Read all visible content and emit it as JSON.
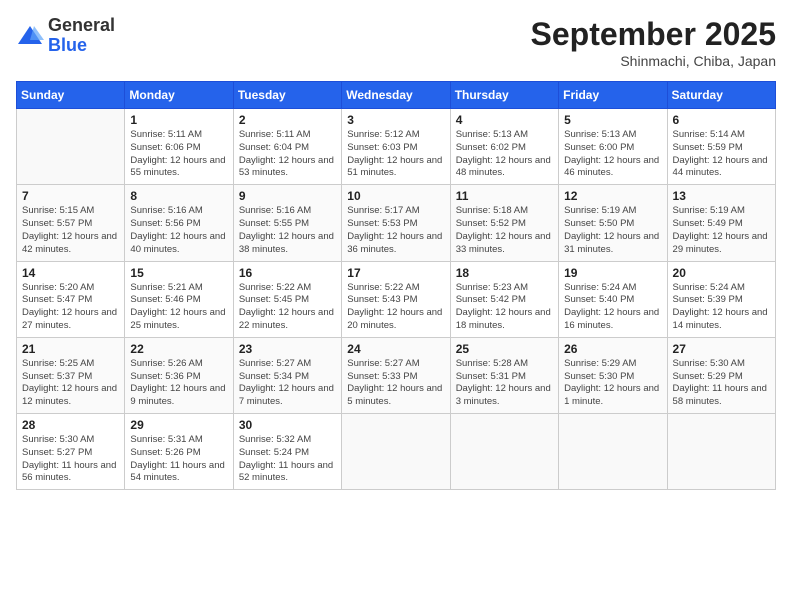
{
  "header": {
    "logo_general": "General",
    "logo_blue": "Blue",
    "month_title": "September 2025",
    "subtitle": "Shinmachi, Chiba, Japan"
  },
  "weekdays": [
    "Sunday",
    "Monday",
    "Tuesday",
    "Wednesday",
    "Thursday",
    "Friday",
    "Saturday"
  ],
  "weeks": [
    [
      {
        "day": "",
        "sunrise": "",
        "sunset": "",
        "daylight": ""
      },
      {
        "day": "1",
        "sunrise": "Sunrise: 5:11 AM",
        "sunset": "Sunset: 6:06 PM",
        "daylight": "Daylight: 12 hours and 55 minutes."
      },
      {
        "day": "2",
        "sunrise": "Sunrise: 5:11 AM",
        "sunset": "Sunset: 6:04 PM",
        "daylight": "Daylight: 12 hours and 53 minutes."
      },
      {
        "day": "3",
        "sunrise": "Sunrise: 5:12 AM",
        "sunset": "Sunset: 6:03 PM",
        "daylight": "Daylight: 12 hours and 51 minutes."
      },
      {
        "day": "4",
        "sunrise": "Sunrise: 5:13 AM",
        "sunset": "Sunset: 6:02 PM",
        "daylight": "Daylight: 12 hours and 48 minutes."
      },
      {
        "day": "5",
        "sunrise": "Sunrise: 5:13 AM",
        "sunset": "Sunset: 6:00 PM",
        "daylight": "Daylight: 12 hours and 46 minutes."
      },
      {
        "day": "6",
        "sunrise": "Sunrise: 5:14 AM",
        "sunset": "Sunset: 5:59 PM",
        "daylight": "Daylight: 12 hours and 44 minutes."
      }
    ],
    [
      {
        "day": "7",
        "sunrise": "Sunrise: 5:15 AM",
        "sunset": "Sunset: 5:57 PM",
        "daylight": "Daylight: 12 hours and 42 minutes."
      },
      {
        "day": "8",
        "sunrise": "Sunrise: 5:16 AM",
        "sunset": "Sunset: 5:56 PM",
        "daylight": "Daylight: 12 hours and 40 minutes."
      },
      {
        "day": "9",
        "sunrise": "Sunrise: 5:16 AM",
        "sunset": "Sunset: 5:55 PM",
        "daylight": "Daylight: 12 hours and 38 minutes."
      },
      {
        "day": "10",
        "sunrise": "Sunrise: 5:17 AM",
        "sunset": "Sunset: 5:53 PM",
        "daylight": "Daylight: 12 hours and 36 minutes."
      },
      {
        "day": "11",
        "sunrise": "Sunrise: 5:18 AM",
        "sunset": "Sunset: 5:52 PM",
        "daylight": "Daylight: 12 hours and 33 minutes."
      },
      {
        "day": "12",
        "sunrise": "Sunrise: 5:19 AM",
        "sunset": "Sunset: 5:50 PM",
        "daylight": "Daylight: 12 hours and 31 minutes."
      },
      {
        "day": "13",
        "sunrise": "Sunrise: 5:19 AM",
        "sunset": "Sunset: 5:49 PM",
        "daylight": "Daylight: 12 hours and 29 minutes."
      }
    ],
    [
      {
        "day": "14",
        "sunrise": "Sunrise: 5:20 AM",
        "sunset": "Sunset: 5:47 PM",
        "daylight": "Daylight: 12 hours and 27 minutes."
      },
      {
        "day": "15",
        "sunrise": "Sunrise: 5:21 AM",
        "sunset": "Sunset: 5:46 PM",
        "daylight": "Daylight: 12 hours and 25 minutes."
      },
      {
        "day": "16",
        "sunrise": "Sunrise: 5:22 AM",
        "sunset": "Sunset: 5:45 PM",
        "daylight": "Daylight: 12 hours and 22 minutes."
      },
      {
        "day": "17",
        "sunrise": "Sunrise: 5:22 AM",
        "sunset": "Sunset: 5:43 PM",
        "daylight": "Daylight: 12 hours and 20 minutes."
      },
      {
        "day": "18",
        "sunrise": "Sunrise: 5:23 AM",
        "sunset": "Sunset: 5:42 PM",
        "daylight": "Daylight: 12 hours and 18 minutes."
      },
      {
        "day": "19",
        "sunrise": "Sunrise: 5:24 AM",
        "sunset": "Sunset: 5:40 PM",
        "daylight": "Daylight: 12 hours and 16 minutes."
      },
      {
        "day": "20",
        "sunrise": "Sunrise: 5:24 AM",
        "sunset": "Sunset: 5:39 PM",
        "daylight": "Daylight: 12 hours and 14 minutes."
      }
    ],
    [
      {
        "day": "21",
        "sunrise": "Sunrise: 5:25 AM",
        "sunset": "Sunset: 5:37 PM",
        "daylight": "Daylight: 12 hours and 12 minutes."
      },
      {
        "day": "22",
        "sunrise": "Sunrise: 5:26 AM",
        "sunset": "Sunset: 5:36 PM",
        "daylight": "Daylight: 12 hours and 9 minutes."
      },
      {
        "day": "23",
        "sunrise": "Sunrise: 5:27 AM",
        "sunset": "Sunset: 5:34 PM",
        "daylight": "Daylight: 12 hours and 7 minutes."
      },
      {
        "day": "24",
        "sunrise": "Sunrise: 5:27 AM",
        "sunset": "Sunset: 5:33 PM",
        "daylight": "Daylight: 12 hours and 5 minutes."
      },
      {
        "day": "25",
        "sunrise": "Sunrise: 5:28 AM",
        "sunset": "Sunset: 5:31 PM",
        "daylight": "Daylight: 12 hours and 3 minutes."
      },
      {
        "day": "26",
        "sunrise": "Sunrise: 5:29 AM",
        "sunset": "Sunset: 5:30 PM",
        "daylight": "Daylight: 12 hours and 1 minute."
      },
      {
        "day": "27",
        "sunrise": "Sunrise: 5:30 AM",
        "sunset": "Sunset: 5:29 PM",
        "daylight": "Daylight: 11 hours and 58 minutes."
      }
    ],
    [
      {
        "day": "28",
        "sunrise": "Sunrise: 5:30 AM",
        "sunset": "Sunset: 5:27 PM",
        "daylight": "Daylight: 11 hours and 56 minutes."
      },
      {
        "day": "29",
        "sunrise": "Sunrise: 5:31 AM",
        "sunset": "Sunset: 5:26 PM",
        "daylight": "Daylight: 11 hours and 54 minutes."
      },
      {
        "day": "30",
        "sunrise": "Sunrise: 5:32 AM",
        "sunset": "Sunset: 5:24 PM",
        "daylight": "Daylight: 11 hours and 52 minutes."
      },
      {
        "day": "",
        "sunrise": "",
        "sunset": "",
        "daylight": ""
      },
      {
        "day": "",
        "sunrise": "",
        "sunset": "",
        "daylight": ""
      },
      {
        "day": "",
        "sunrise": "",
        "sunset": "",
        "daylight": ""
      },
      {
        "day": "",
        "sunrise": "",
        "sunset": "",
        "daylight": ""
      }
    ]
  ]
}
